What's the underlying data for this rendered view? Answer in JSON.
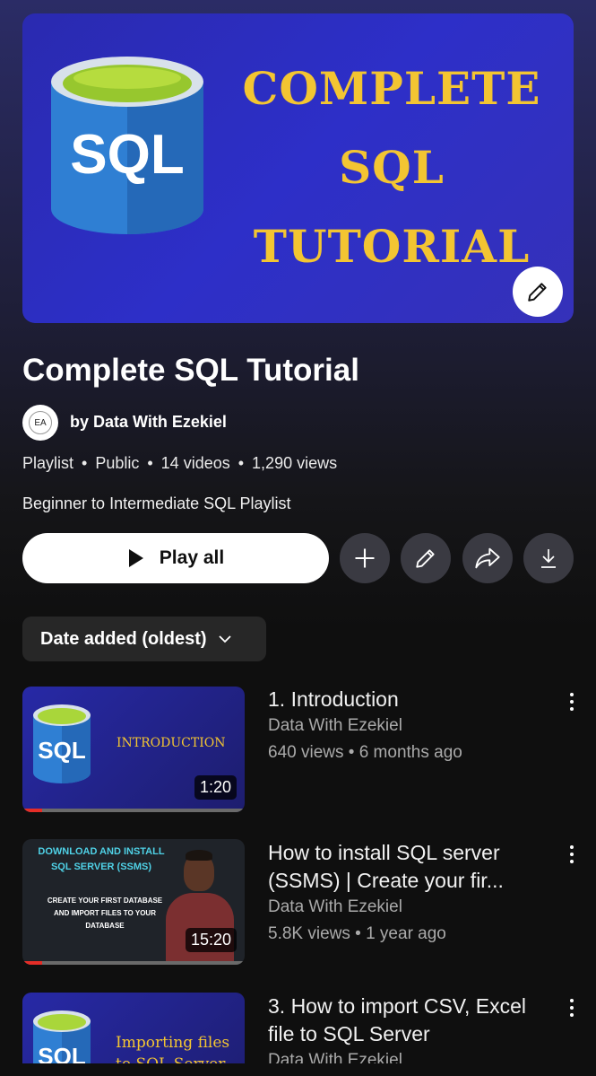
{
  "hero": {
    "logo_text": "SQL",
    "title_lines": [
      "COMPLETE",
      "SQL",
      "TUTORIAL"
    ],
    "edit_icon": "pencil-icon"
  },
  "playlist": {
    "title": "Complete SQL Tutorial",
    "avatar_text": "EA",
    "owner": "by Data With Ezekiel",
    "type": "Playlist",
    "visibility": "Public",
    "video_count": "14 videos",
    "views": "1,290 views",
    "description": "Beginner to Intermediate SQL Playlist"
  },
  "actions": {
    "play_all": "Play all",
    "icons": [
      "plus-icon",
      "pencil-icon",
      "share-icon",
      "download-icon"
    ]
  },
  "sort": {
    "label": "Date added (oldest)"
  },
  "videos": [
    {
      "title": "1.  Introduction",
      "channel": "Data With Ezekiel",
      "meta": "640 views • 6 months ago",
      "duration": "1:20",
      "thumb_logo": "SQL",
      "thumb_text": "INTRODUCTION",
      "watched_fraction": 0.09
    },
    {
      "title": "How to install SQL server (SSMS) | Create your fir...",
      "channel": "Data With Ezekiel",
      "meta": "5.8K views • 1 year ago",
      "duration": "15:20",
      "thumb_heading": "DOWNLOAD AND INSTALL SQL SERVER (SSMS)",
      "thumb_sub": "CREATE YOUR FIRST DATABASE AND IMPORT FILES TO YOUR DATABASE",
      "watched_fraction": 0.09
    },
    {
      "title": "3.  How to import CSV, Excel file to SQL Server",
      "channel": "Data With Ezekiel",
      "thumb_logo": "SQL",
      "thumb_text": "Importing files to SQL Server"
    }
  ],
  "colors": {
    "accent_gold": "#f3c532",
    "progress_red": "#e52d27",
    "hero_blue": "#2d2fc8"
  }
}
